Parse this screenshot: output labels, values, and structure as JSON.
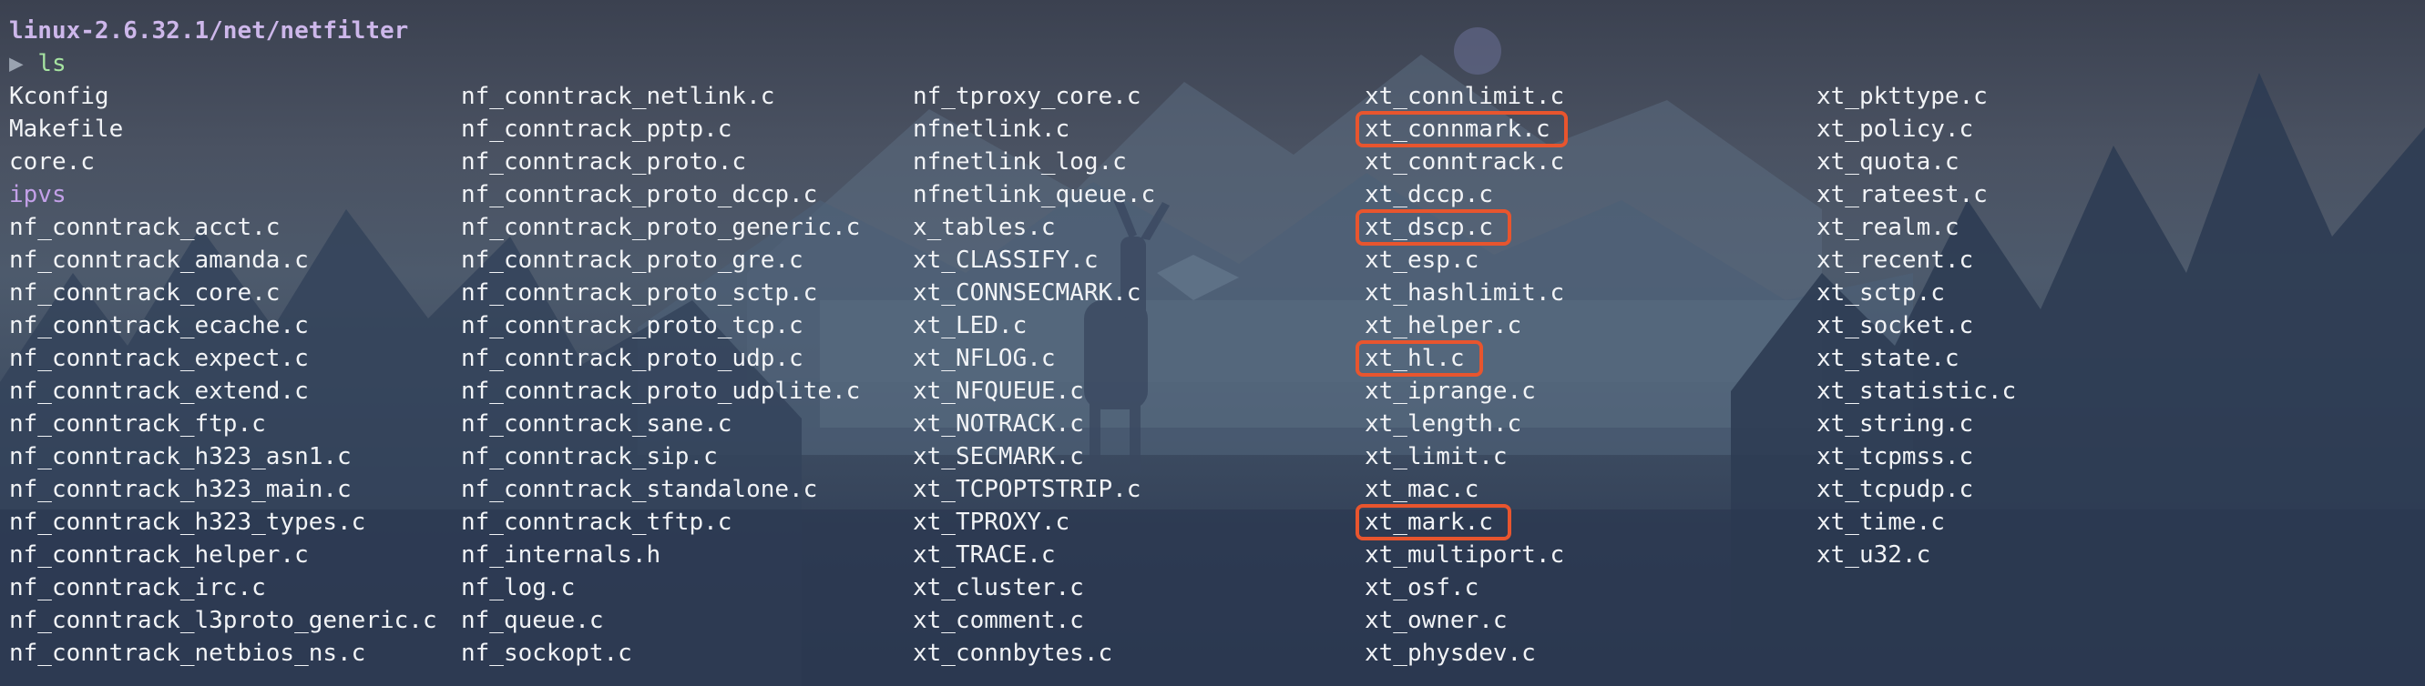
{
  "terminal": {
    "path": "linux-2.6.32.1/net/netfilter",
    "prompt_symbol": "▶",
    "command": "ls"
  },
  "listing": {
    "columns": [
      {
        "entries": [
          {
            "name": "Kconfig",
            "type": "file"
          },
          {
            "name": "Makefile",
            "type": "file"
          },
          {
            "name": "core.c",
            "type": "file"
          },
          {
            "name": "ipvs",
            "type": "dir"
          },
          {
            "name": "nf_conntrack_acct.c",
            "type": "file"
          },
          {
            "name": "nf_conntrack_amanda.c",
            "type": "file"
          },
          {
            "name": "nf_conntrack_core.c",
            "type": "file"
          },
          {
            "name": "nf_conntrack_ecache.c",
            "type": "file"
          },
          {
            "name": "nf_conntrack_expect.c",
            "type": "file"
          },
          {
            "name": "nf_conntrack_extend.c",
            "type": "file"
          },
          {
            "name": "nf_conntrack_ftp.c",
            "type": "file"
          },
          {
            "name": "nf_conntrack_h323_asn1.c",
            "type": "file"
          },
          {
            "name": "nf_conntrack_h323_main.c",
            "type": "file"
          },
          {
            "name": "nf_conntrack_h323_types.c",
            "type": "file"
          },
          {
            "name": "nf_conntrack_helper.c",
            "type": "file"
          },
          {
            "name": "nf_conntrack_irc.c",
            "type": "file"
          },
          {
            "name": "nf_conntrack_l3proto_generic.c",
            "type": "file"
          },
          {
            "name": "nf_conntrack_netbios_ns.c",
            "type": "file"
          }
        ]
      },
      {
        "entries": [
          {
            "name": "nf_conntrack_netlink.c",
            "type": "file"
          },
          {
            "name": "nf_conntrack_pptp.c",
            "type": "file"
          },
          {
            "name": "nf_conntrack_proto.c",
            "type": "file"
          },
          {
            "name": "nf_conntrack_proto_dccp.c",
            "type": "file"
          },
          {
            "name": "nf_conntrack_proto_generic.c",
            "type": "file"
          },
          {
            "name": "nf_conntrack_proto_gre.c",
            "type": "file"
          },
          {
            "name": "nf_conntrack_proto_sctp.c",
            "type": "file"
          },
          {
            "name": "nf_conntrack_proto_tcp.c",
            "type": "file"
          },
          {
            "name": "nf_conntrack_proto_udp.c",
            "type": "file"
          },
          {
            "name": "nf_conntrack_proto_udplite.c",
            "type": "file"
          },
          {
            "name": "nf_conntrack_sane.c",
            "type": "file"
          },
          {
            "name": "nf_conntrack_sip.c",
            "type": "file"
          },
          {
            "name": "nf_conntrack_standalone.c",
            "type": "file"
          },
          {
            "name": "nf_conntrack_tftp.c",
            "type": "file"
          },
          {
            "name": "nf_internals.h",
            "type": "file"
          },
          {
            "name": "nf_log.c",
            "type": "file"
          },
          {
            "name": "nf_queue.c",
            "type": "file"
          },
          {
            "name": "nf_sockopt.c",
            "type": "file"
          }
        ]
      },
      {
        "entries": [
          {
            "name": "nf_tproxy_core.c",
            "type": "file"
          },
          {
            "name": "nfnetlink.c",
            "type": "file"
          },
          {
            "name": "nfnetlink_log.c",
            "type": "file"
          },
          {
            "name": "nfnetlink_queue.c",
            "type": "file"
          },
          {
            "name": "x_tables.c",
            "type": "file"
          },
          {
            "name": "xt_CLASSIFY.c",
            "type": "file"
          },
          {
            "name": "xt_CONNSECMARK.c",
            "type": "file"
          },
          {
            "name": "xt_LED.c",
            "type": "file"
          },
          {
            "name": "xt_NFLOG.c",
            "type": "file"
          },
          {
            "name": "xt_NFQUEUE.c",
            "type": "file"
          },
          {
            "name": "xt_NOTRACK.c",
            "type": "file"
          },
          {
            "name": "xt_SECMARK.c",
            "type": "file"
          },
          {
            "name": "xt_TCPOPTSTRIP.c",
            "type": "file"
          },
          {
            "name": "xt_TPROXY.c",
            "type": "file"
          },
          {
            "name": "xt_TRACE.c",
            "type": "file"
          },
          {
            "name": "xt_cluster.c",
            "type": "file"
          },
          {
            "name": "xt_comment.c",
            "type": "file"
          },
          {
            "name": "xt_connbytes.c",
            "type": "file"
          }
        ]
      },
      {
        "entries": [
          {
            "name": "xt_connlimit.c",
            "type": "file"
          },
          {
            "name": "xt_connmark.c",
            "type": "file",
            "highlighted": true
          },
          {
            "name": "xt_conntrack.c",
            "type": "file"
          },
          {
            "name": "xt_dccp.c",
            "type": "file"
          },
          {
            "name": "xt_dscp.c",
            "type": "file",
            "highlighted": true
          },
          {
            "name": "xt_esp.c",
            "type": "file"
          },
          {
            "name": "xt_hashlimit.c",
            "type": "file"
          },
          {
            "name": "xt_helper.c",
            "type": "file"
          },
          {
            "name": "xt_hl.c",
            "type": "file",
            "highlighted": true
          },
          {
            "name": "xt_iprange.c",
            "type": "file"
          },
          {
            "name": "xt_length.c",
            "type": "file"
          },
          {
            "name": "xt_limit.c",
            "type": "file"
          },
          {
            "name": "xt_mac.c",
            "type": "file"
          },
          {
            "name": "xt_mark.c",
            "type": "file",
            "highlighted": true
          },
          {
            "name": "xt_multiport.c",
            "type": "file"
          },
          {
            "name": "xt_osf.c",
            "type": "file"
          },
          {
            "name": "xt_owner.c",
            "type": "file"
          },
          {
            "name": "xt_physdev.c",
            "type": "file"
          }
        ]
      },
      {
        "entries": [
          {
            "name": "xt_pkttype.c",
            "type": "file"
          },
          {
            "name": "xt_policy.c",
            "type": "file"
          },
          {
            "name": "xt_quota.c",
            "type": "file"
          },
          {
            "name": "xt_rateest.c",
            "type": "file"
          },
          {
            "name": "xt_realm.c",
            "type": "file"
          },
          {
            "name": "xt_recent.c",
            "type": "file"
          },
          {
            "name": "xt_sctp.c",
            "type": "file"
          },
          {
            "name": "xt_socket.c",
            "type": "file"
          },
          {
            "name": "xt_state.c",
            "type": "file"
          },
          {
            "name": "xt_statistic.c",
            "type": "file"
          },
          {
            "name": "xt_string.c",
            "type": "file"
          },
          {
            "name": "xt_tcpmss.c",
            "type": "file"
          },
          {
            "name": "xt_tcpudp.c",
            "type": "file"
          },
          {
            "name": "xt_time.c",
            "type": "file"
          },
          {
            "name": "xt_u32.c",
            "type": "file"
          }
        ]
      }
    ]
  },
  "colors": {
    "path": "#cdb7ea",
    "command": "#a6e3a1",
    "file": "#f1f3f6",
    "directory": "#c3a0e8",
    "highlight_box": "#e8552e"
  }
}
